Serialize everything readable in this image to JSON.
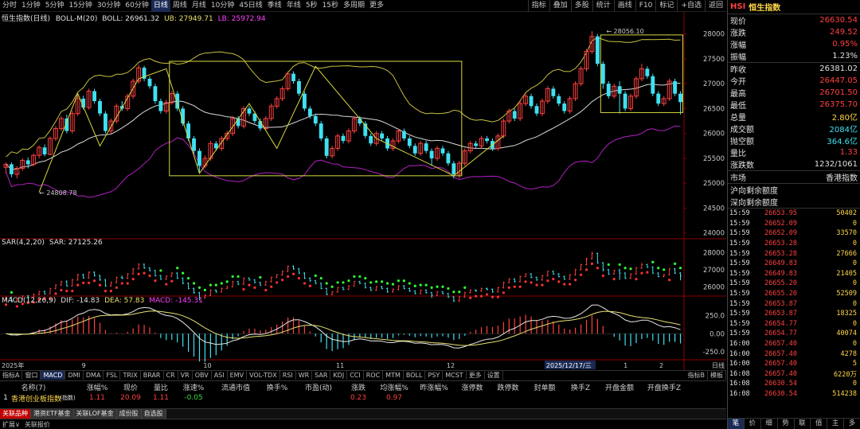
{
  "toolbar": {
    "periods": [
      "分时",
      "1分钟",
      "5分钟",
      "15分钟",
      "30分钟",
      "60分钟",
      "日线",
      "周线",
      "月线",
      "10分钟",
      "45日线",
      "季线",
      "年线",
      "5秒",
      "15秒",
      "多周期",
      "更多"
    ],
    "active_period": 6,
    "tools": [
      "指标",
      "叠加",
      "多股",
      "统计",
      "画线",
      "F10",
      "标记",
      "+自选",
      "返回"
    ]
  },
  "main_panel": {
    "title": "恒生指数(日线)",
    "indicator": "BOLL-M(20)",
    "boll_label": "BOLL: 26961.32",
    "ub_label": "UB: 27949.71",
    "lb_label": "LB: 25972.94",
    "y_ticks": [
      "28000",
      "27500",
      "27000",
      "26500",
      "26000",
      "25500",
      "25000",
      "24500",
      "24000"
    ],
    "high_marker": "28056.10",
    "low_marker": "24808.78"
  },
  "sar_panel": {
    "indicator": "SAR(4,2,20)",
    "value_label": "SAR: 27125.26",
    "y_ticks": [
      "28000",
      "27000",
      "26000"
    ]
  },
  "macd_panel": {
    "indicator": "MACD(12,26,9)",
    "dif_label": "DIF: -14.83",
    "dea_label": "DEA: 57.83",
    "macd_label": "MACD: -145.31",
    "y_ticks": [
      "250.0",
      "0.00",
      "-250.0"
    ]
  },
  "x_axis": {
    "labels": [
      "2025年",
      "9",
      "10",
      "11",
      "12",
      "2025/12/17/三",
      "1",
      "2"
    ],
    "right_label": "日线"
  },
  "indicator_tabs": [
    "指标A",
    "窗口",
    "MACD",
    "DMI",
    "DMA",
    "FSL",
    "TRIX",
    "BRAR",
    "CR",
    "VR",
    "OBV",
    "ASI",
    "EMV",
    "VOL-TDX",
    "RSI",
    "WR",
    "SAR",
    "KDJ",
    "CCI",
    "ROC",
    "MTM",
    "BOLL",
    "PSY",
    "MCST",
    "更多",
    "设置"
  ],
  "indicator_tabs_active": 2,
  "indicator_tabs_right": [
    "指标B",
    "模板"
  ],
  "watchlist": {
    "headers": [
      "",
      "名称(7)",
      "",
      "涨幅%",
      "现价",
      "量比",
      "涨速%",
      "流通市值",
      "换手%",
      "市盈(动)",
      "涨跌",
      "均涨幅%",
      "昨涨幅%",
      "涨停数",
      "跌停数",
      "封单额",
      "换手Z",
      "开盘金额",
      "开盘换手Z"
    ],
    "row": [
      "1",
      "香港创业板指数",
      "(指数)",
      "1.11",
      "20.09",
      "1.11",
      "-0.05",
      "",
      "",
      "",
      "0.23",
      "0.97",
      "",
      "",
      "",
      "",
      "",
      "",
      ""
    ]
  },
  "bottom_tabs": [
    "关联品种",
    "港资ETF基金",
    "关联LOF基金",
    "成份股",
    "自选股"
  ],
  "status_bar": [
    "扩展∨",
    "关联报价"
  ],
  "right_panel": {
    "code": "HSI",
    "name": "恒生指数",
    "quote_rows": [
      {
        "k": "现价",
        "v": "26630.54",
        "c": "red"
      },
      {
        "k": "涨跌",
        "v": "249.52",
        "c": "red"
      },
      {
        "k": "涨幅",
        "v": "0.95%",
        "c": "red"
      },
      {
        "k": "振幅",
        "v": "1.23%",
        "c": "white"
      }
    ],
    "quote_rows2": [
      {
        "k": "昨收",
        "v": "26381.02",
        "c": "white"
      },
      {
        "k": "今开",
        "v": "26447.05",
        "c": "red"
      },
      {
        "k": "最高",
        "v": "26701.50",
        "c": "red"
      },
      {
        "k": "最低",
        "v": "26375.70",
        "c": "red"
      },
      {
        "k": "总量",
        "v": "2.80亿",
        "c": "yellow"
      },
      {
        "k": "成交额",
        "v": "2084亿",
        "c": "cyan"
      },
      {
        "k": "抛空额",
        "v": "364.6亿",
        "c": "cyan"
      },
      {
        "k": "量比",
        "v": "1.33",
        "c": "red"
      },
      {
        "k": "涨跌数",
        "v": "1232/1061",
        "c": "white"
      }
    ],
    "market_label": "市场",
    "market_value": "香港指数",
    "quota_rows": [
      "沪向剩余额度",
      "深向剩余额度"
    ],
    "ticks": [
      {
        "t": "15:59",
        "p": "26653.95",
        "v": "50402"
      },
      {
        "t": "15:59",
        "p": "26652.09",
        "v": "0"
      },
      {
        "t": "15:59",
        "p": "26652.09",
        "v": "33570"
      },
      {
        "t": "15:59",
        "p": "26653.28",
        "v": "0"
      },
      {
        "t": "15:59",
        "p": "26653.28",
        "v": "27666"
      },
      {
        "t": "15:59",
        "p": "26649.83",
        "v": "0"
      },
      {
        "t": "15:59",
        "p": "26649.83",
        "v": "21405"
      },
      {
        "t": "15:59",
        "p": "26655.20",
        "v": "0"
      },
      {
        "t": "15:59",
        "p": "26655.20",
        "v": "52509"
      },
      {
        "t": "15:59",
        "p": "26653.87",
        "v": "0"
      },
      {
        "t": "15:59",
        "p": "26653.87",
        "v": "18325"
      },
      {
        "t": "15:59",
        "p": "26654.77",
        "v": "0"
      },
      {
        "t": "15:59",
        "p": "26654.77",
        "v": "40074"
      },
      {
        "t": "16:00",
        "p": "26657.40",
        "v": "0"
      },
      {
        "t": "16:00",
        "p": "26657.40",
        "v": "4278"
      },
      {
        "t": "16:00",
        "p": "26657.40",
        "v": "5"
      },
      {
        "t": "16:08",
        "p": "26657.40",
        "v": "6220万"
      },
      {
        "t": "16:08",
        "p": "26630.54",
        "v": "0"
      },
      {
        "t": "16:08",
        "p": "26630.54",
        "v": "514238"
      }
    ],
    "bottom_tabs": [
      "笔",
      "价",
      "细",
      "势",
      "联",
      "值",
      "主",
      "多"
    ]
  },
  "colors": {
    "up": "#ff4040",
    "down": "#40e0f0",
    "boll_mid": "#d8d8d8",
    "boll_band": "#c8c040",
    "lb": "#b020c0",
    "box": "#d8d840"
  },
  "candles": [
    [
      25320,
      25380,
      25200,
      25420
    ],
    [
      25380,
      25180,
      25120,
      25420
    ],
    [
      25180,
      25300,
      25100,
      25340
    ],
    [
      25300,
      25460,
      25250,
      25500
    ],
    [
      25460,
      25380,
      25300,
      25520
    ],
    [
      25380,
      25560,
      25340,
      25600
    ],
    [
      25560,
      25720,
      25500,
      25760
    ],
    [
      25720,
      25580,
      25540,
      25780
    ],
    [
      25580,
      25900,
      25560,
      25940
    ],
    [
      25900,
      26100,
      25850,
      26150
    ],
    [
      26100,
      26300,
      26050,
      26350
    ],
    [
      26300,
      26050,
      26000,
      26380
    ],
    [
      26050,
      26400,
      26000,
      26460
    ],
    [
      26400,
      26700,
      26350,
      26760
    ],
    [
      26700,
      26520,
      26480,
      26760
    ],
    [
      26520,
      26850,
      26480,
      26900
    ],
    [
      26850,
      26650,
      26600,
      26900
    ],
    [
      26650,
      26400,
      26350,
      26700
    ],
    [
      26400,
      26050,
      26000,
      26450
    ],
    [
      26050,
      26250,
      26000,
      26300
    ],
    [
      26250,
      26550,
      26200,
      26600
    ],
    [
      26550,
      26500,
      26450,
      26650
    ],
    [
      26500,
      26750,
      26450,
      26800
    ],
    [
      26750,
      27050,
      26700,
      27100
    ],
    [
      27050,
      27320,
      27000,
      27380
    ],
    [
      27320,
      27100,
      27050,
      27360
    ],
    [
      27100,
      26950,
      26900,
      27150
    ],
    [
      26950,
      26650,
      26600,
      27000
    ],
    [
      26650,
      26450,
      26400,
      26700
    ],
    [
      26450,
      26620,
      26400,
      26680
    ],
    [
      26620,
      26800,
      26580,
      26850
    ],
    [
      26800,
      26500,
      26450,
      26850
    ],
    [
      26500,
      26200,
      26150,
      26550
    ],
    [
      26200,
      25900,
      25850,
      26250
    ],
    [
      25900,
      25650,
      25600,
      25950
    ],
    [
      25650,
      25350,
      25200,
      25700
    ],
    [
      25350,
      25500,
      25300,
      25560
    ],
    [
      25500,
      25800,
      25450,
      25850
    ],
    [
      25800,
      25700,
      25650,
      25850
    ],
    [
      25700,
      25900,
      25650,
      25950
    ],
    [
      25900,
      26000,
      25850,
      26050
    ],
    [
      26000,
      26300,
      25950,
      26350
    ],
    [
      26300,
      26150,
      26100,
      26350
    ],
    [
      26150,
      26500,
      26100,
      26550
    ],
    [
      26500,
      26400,
      26350,
      26550
    ],
    [
      26400,
      26250,
      26200,
      26450
    ],
    [
      26250,
      26100,
      26050,
      26300
    ],
    [
      26100,
      26300,
      26050,
      26350
    ],
    [
      26300,
      26550,
      26250,
      26600
    ],
    [
      26550,
      26700,
      26500,
      26750
    ],
    [
      26700,
      26900,
      26650,
      26950
    ],
    [
      26900,
      27200,
      26850,
      27250
    ],
    [
      27200,
      27050,
      27000,
      27250
    ],
    [
      27050,
      26800,
      26750,
      27100
    ],
    [
      26800,
      26500,
      26450,
      26850
    ],
    [
      26500,
      26350,
      26300,
      26550
    ],
    [
      26350,
      26200,
      26150,
      26400
    ],
    [
      26200,
      25900,
      25850,
      26250
    ],
    [
      25900,
      25550,
      25500,
      25950
    ],
    [
      25550,
      25700,
      25500,
      25750
    ],
    [
      25700,
      25950,
      25650,
      26000
    ],
    [
      25950,
      25850,
      25800,
      26000
    ],
    [
      25850,
      26050,
      25800,
      26100
    ],
    [
      26050,
      26300,
      26000,
      26350
    ],
    [
      26300,
      26200,
      26150,
      26350
    ],
    [
      26200,
      25950,
      25900,
      26250
    ],
    [
      25950,
      25800,
      25750,
      26000
    ],
    [
      25800,
      26000,
      25750,
      26050
    ],
    [
      26000,
      25900,
      25850,
      26050
    ],
    [
      25900,
      25700,
      25650,
      25950
    ],
    [
      25700,
      25850,
      25650,
      25900
    ],
    [
      25850,
      26050,
      25800,
      26100
    ],
    [
      26050,
      25900,
      25850,
      26100
    ],
    [
      25900,
      25750,
      25700,
      25950
    ],
    [
      25750,
      25600,
      25550,
      25800
    ],
    [
      25600,
      25800,
      25550,
      25850
    ],
    [
      25800,
      25650,
      25600,
      25850
    ],
    [
      25650,
      25500,
      25350,
      25700
    ],
    [
      25500,
      25700,
      25450,
      25750
    ],
    [
      25700,
      25600,
      25550,
      25750
    ],
    [
      25600,
      25400,
      25350,
      25650
    ],
    [
      25400,
      25180,
      25100,
      25450
    ],
    [
      25180,
      25400,
      25100,
      25450
    ],
    [
      25400,
      25650,
      25350,
      25700
    ],
    [
      25650,
      25800,
      25600,
      25850
    ],
    [
      25800,
      25750,
      25700,
      25850
    ],
    [
      25750,
      25900,
      25700,
      25950
    ],
    [
      25900,
      25850,
      25800,
      25950
    ],
    [
      25850,
      25700,
      25650,
      25900
    ],
    [
      25700,
      25950,
      25650,
      26000
    ],
    [
      25950,
      26250,
      25900,
      26300
    ],
    [
      26250,
      26450,
      26200,
      26500
    ],
    [
      26450,
      26300,
      26250,
      26500
    ],
    [
      26300,
      26600,
      26250,
      26650
    ],
    [
      26600,
      26750,
      26550,
      26800
    ],
    [
      26750,
      26550,
      26500,
      26800
    ],
    [
      26550,
      26400,
      26350,
      26600
    ],
    [
      26400,
      26650,
      26350,
      26700
    ],
    [
      26650,
      26900,
      26600,
      26950
    ],
    [
      26900,
      26750,
      26700,
      26950
    ],
    [
      26750,
      26600,
      26550,
      26800
    ],
    [
      26600,
      26450,
      26400,
      26650
    ],
    [
      26450,
      26700,
      26400,
      26750
    ],
    [
      26700,
      27000,
      26650,
      27050
    ],
    [
      27000,
      27300,
      26950,
      27350
    ],
    [
      27300,
      27650,
      27250,
      27700
    ],
    [
      27650,
      27950,
      27600,
      28056
    ],
    [
      27950,
      27400,
      27350,
      28000
    ],
    [
      27400,
      27000,
      26900,
      27450
    ],
    [
      27000,
      26750,
      26700,
      27050
    ],
    [
      26750,
      26950,
      26700,
      27000
    ],
    [
      26950,
      26800,
      26400,
      27050
    ],
    [
      26800,
      26500,
      26450,
      26850
    ],
    [
      26500,
      26750,
      26450,
      26800
    ],
    [
      26750,
      27100,
      26700,
      27150
    ],
    [
      27100,
      27300,
      27050,
      27400
    ],
    [
      27300,
      27150,
      27100,
      27350
    ],
    [
      27150,
      26800,
      26750,
      27200
    ],
    [
      26800,
      26600,
      26550,
      26850
    ],
    [
      26600,
      26700,
      26550,
      26750
    ],
    [
      26700,
      27050,
      26650,
      27100
    ],
    [
      27050,
      26800,
      26750,
      27100
    ],
    [
      26800,
      26630,
      26380,
      26850
    ]
  ]
}
